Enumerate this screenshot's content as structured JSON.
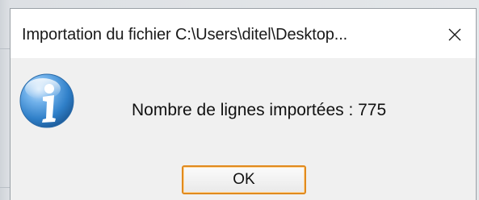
{
  "dialog": {
    "title": "Importation du fichier C:\\Users\\ditel\\Desktop...",
    "close_icon": "close-icon",
    "message": "Nombre de lignes importées : 775",
    "info_icon": "information-icon",
    "ok_label": "OK"
  },
  "colors": {
    "button_focus_border": "#e08a1e",
    "body_background": "#f0f0f0",
    "icon_blue": "#2f7fc8"
  }
}
